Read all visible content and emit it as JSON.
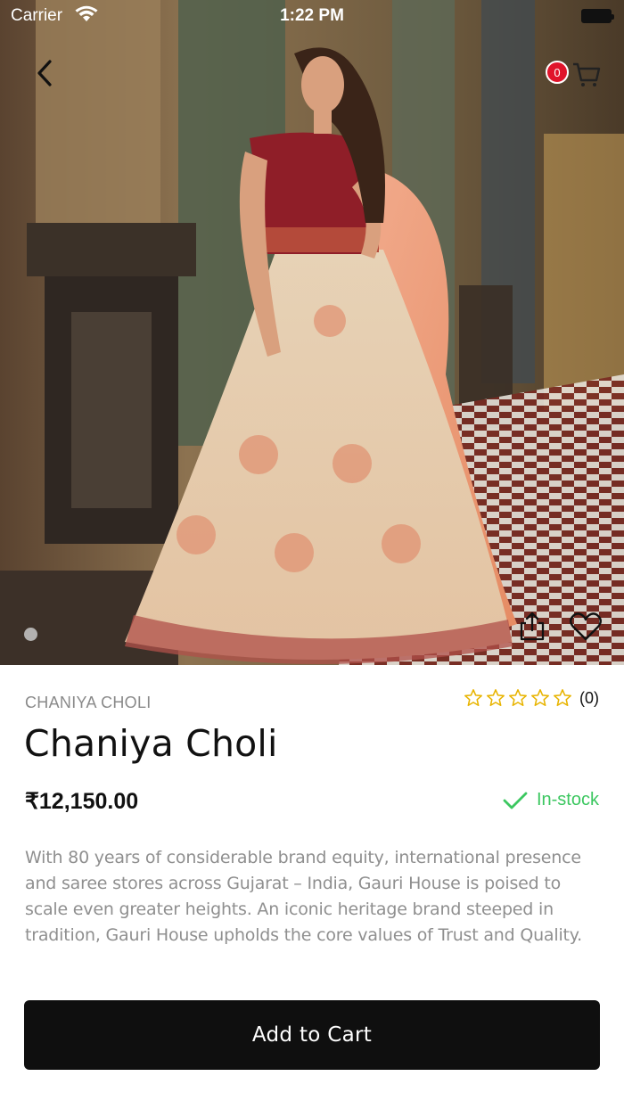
{
  "status_bar": {
    "carrier": "Carrier",
    "time": "1:22 PM"
  },
  "navigation": {
    "cart_count": "0"
  },
  "product": {
    "category": "CHANIYA CHOLI",
    "title": "Chaniya Choli",
    "price": "₹12,150.00",
    "rating_stars": 0,
    "rating_max": 5,
    "rating_count": "(0)",
    "stock_status": "In-stock",
    "description": "With 80 years of considerable brand equity, international presence and saree stores across Gujarat – India, Gauri House is poised to scale even greater heights. An iconic heritage brand steeped in tradition, Gauri House upholds the core values of Trust and Quality.",
    "image_page_count": 1,
    "image_current_page": 1
  },
  "actions": {
    "add_to_cart_label": "Add to Cart"
  },
  "colors": {
    "accent_star": "#e8b400",
    "in_stock": "#3cc760",
    "badge": "#e0142b",
    "button_bg": "#0f0f0f"
  },
  "icons": [
    "back-chevron-icon",
    "cart-icon",
    "share-icon",
    "heart-icon",
    "star-icon",
    "checkmark-icon",
    "wifi-icon",
    "battery-icon"
  ]
}
